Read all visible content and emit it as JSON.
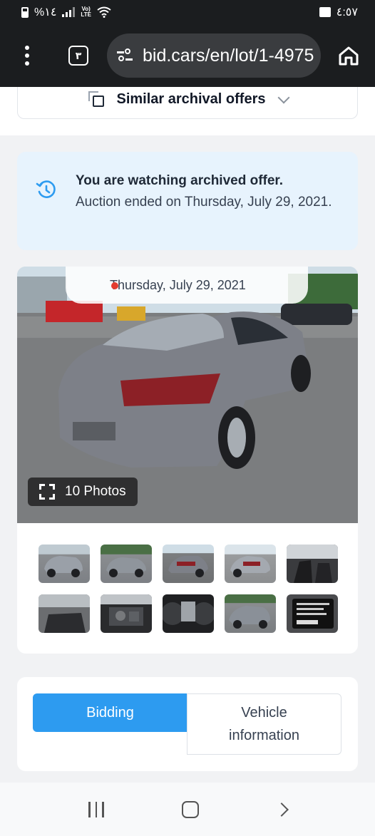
{
  "status_bar": {
    "battery_percent": "%١٤",
    "time": "٤:٥٧"
  },
  "browser": {
    "tab_count": "٣",
    "url": "bid.cars/en/lot/1-4975"
  },
  "similar": {
    "label": "Similar archival offers"
  },
  "notice": {
    "title": "You are watching archived offer.",
    "body": "Auction ended on Thursday, July 29, 2021."
  },
  "gallery": {
    "date": "Thursday, July 29, 2021",
    "photos_label": "10 Photos",
    "thumbnails": [
      {
        "subject": "front-left-damage"
      },
      {
        "subject": "front-right"
      },
      {
        "subject": "rear-left"
      },
      {
        "subject": "rear-right"
      },
      {
        "subject": "interior-front"
      },
      {
        "subject": "interior-rear"
      },
      {
        "subject": "engine-bay"
      },
      {
        "subject": "instrument-cluster"
      },
      {
        "subject": "front-damage"
      },
      {
        "subject": "vin-label"
      }
    ]
  },
  "tabs": {
    "bidding": "Bidding",
    "vehicle_info": "Vehicle information",
    "active": "Bidding"
  },
  "colors": {
    "accent": "#2d9bf0",
    "notice_bg": "#e7f3fd",
    "live_dot": "#e33b2f"
  }
}
